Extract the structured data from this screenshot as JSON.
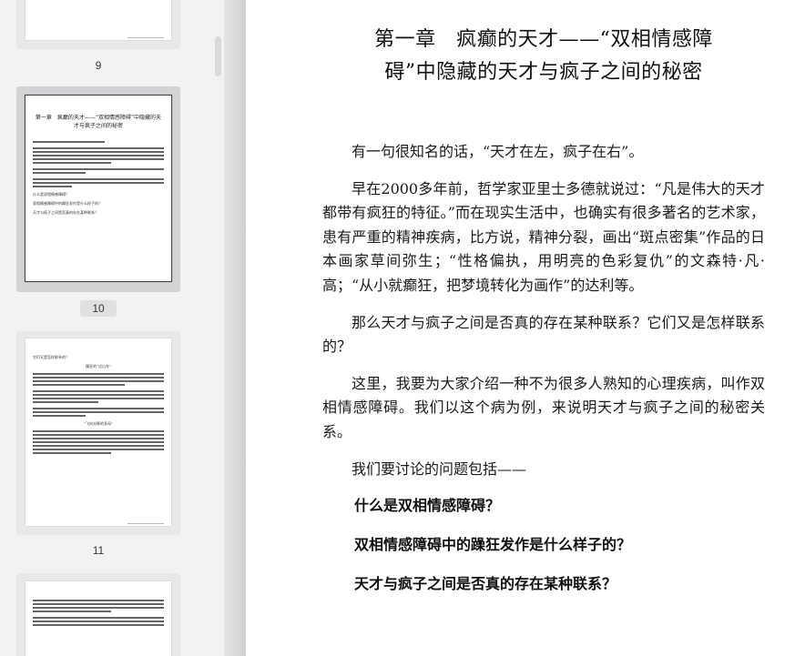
{
  "sidebar": {
    "pages": [
      {
        "number": "9"
      },
      {
        "number": "10",
        "mini_title": "第一章　疯癫的天才——“双相情感障碍”中隐藏的天才与疯子之间的秘密",
        "mini_questions": [
          "什么是双相情感障碍？",
          "双相情感障碍中的躁狂发作是什么样子的？",
          "天才与疯子之间是否真的存在某种联系？"
        ]
      },
      {
        "number": "11",
        "mini_headings": [
          "它们又是怎样联系的？",
          "躁狂的“过山车”",
          "“飞向光辉的圣母”"
        ]
      },
      {
        "number": ""
      }
    ]
  },
  "document": {
    "chapter_title_line1": "第一章　疯癫的天才——“双相情感障",
    "chapter_title_line2": "碍”中隐藏的天才与疯子之间的秘密",
    "paragraphs": [
      "有一句很知名的话，“天才在左，疯子在右”。",
      "早在2000多年前，哲学家亚里士多德就说过：“凡是伟大的天才都带有疯狂的特征。”而在现实生活中，也确实有很多著名的艺术家，患有严重的精神疾病，比方说，精神分裂，画出“斑点密集”作品的日本画家草间弥生；“性格偏执，用明亮的色彩复仇”的文森特·凡·高；“从小就癫狂，把梦境转化为画作”的达利等。",
      "那么天才与疯子之间是否真的存在某种联系？它们又是怎样联系的？",
      "这里，我要为大家介绍一种不为很多人熟知的心理疾病，叫作双相情感障碍。我们以这个病为例，来说明天才与疯子之间的秘密关系。",
      "我们要讨论的问题包括——"
    ],
    "questions": [
      "什么是双相情感障碍？",
      "双相情感障碍中的躁狂发作是什么样子的？",
      "天才与疯子之间是否真的存在某种联系？"
    ]
  }
}
